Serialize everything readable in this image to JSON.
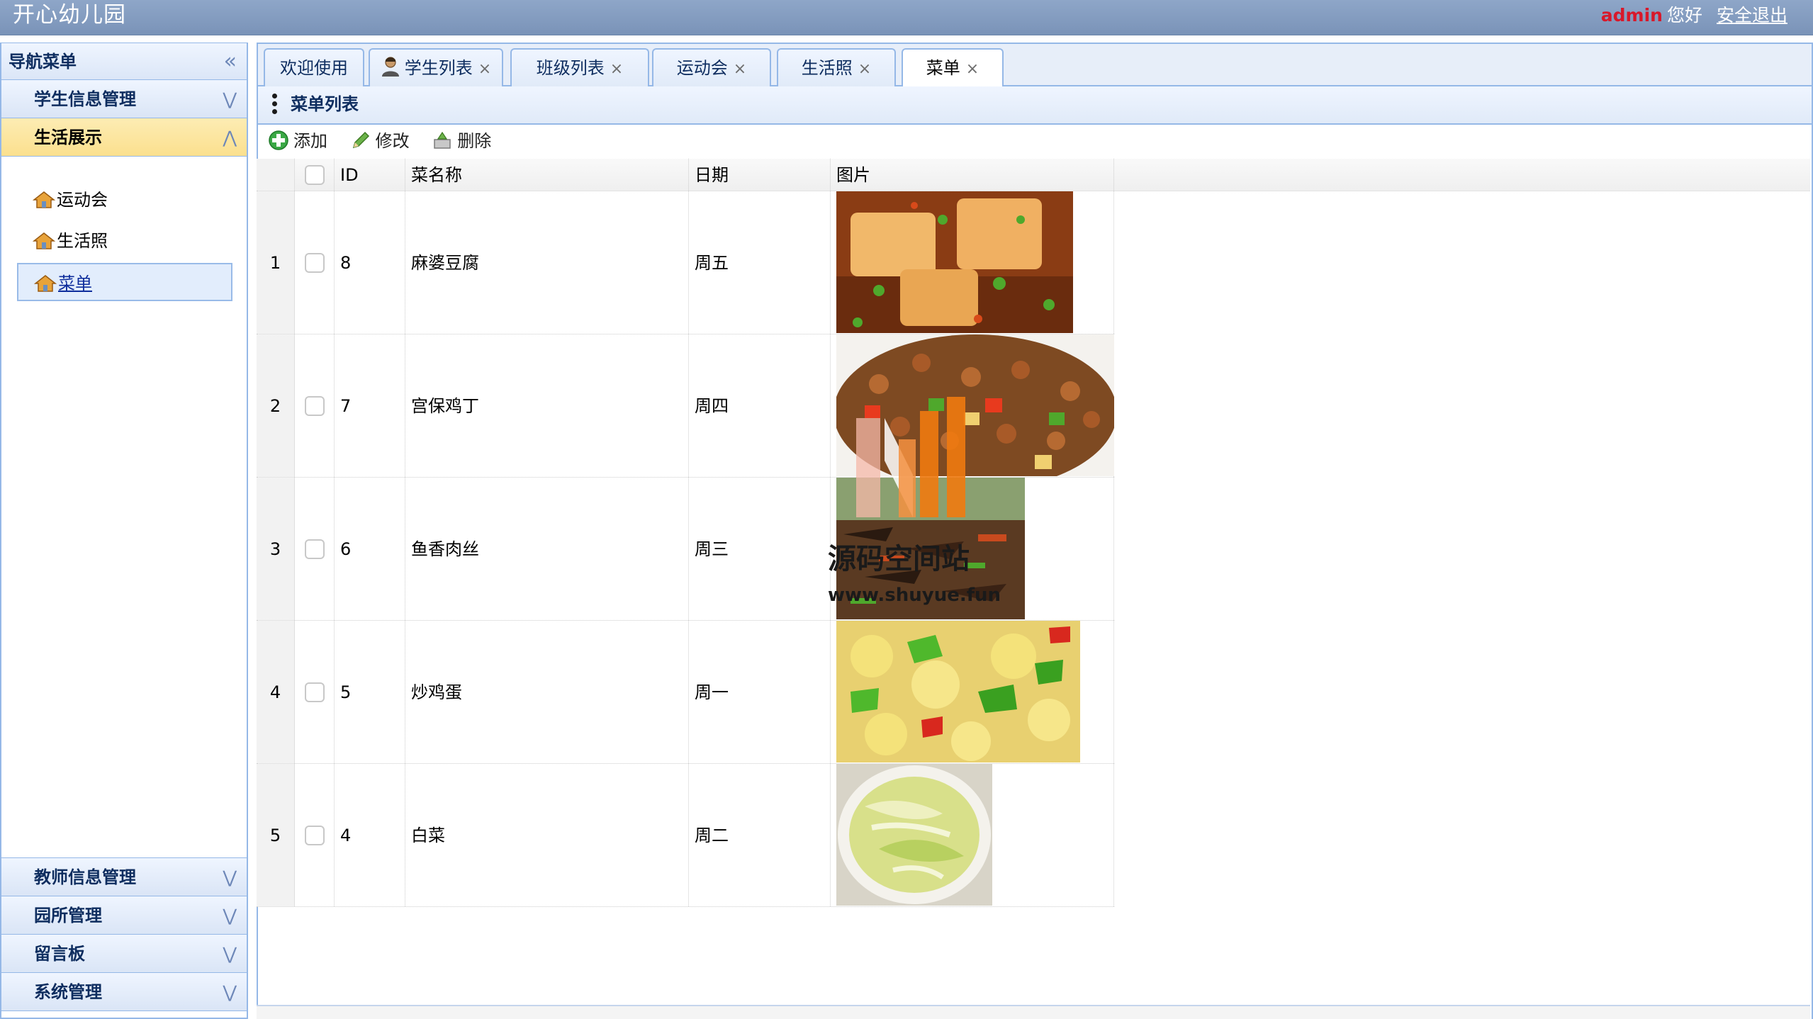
{
  "header": {
    "app_title": "开心幼儿园",
    "username": "admin",
    "greeting": "您好",
    "logout": "安全退出"
  },
  "sidebar": {
    "title": "导航菜单",
    "sections": [
      {
        "label": "学生信息管理",
        "state": "collapsed"
      },
      {
        "label": "生活展示",
        "state": "expanded"
      }
    ],
    "links": [
      {
        "label": "运动会",
        "selected": false
      },
      {
        "label": "生活照",
        "selected": false
      },
      {
        "label": "菜单",
        "selected": true
      }
    ],
    "bottom_sections": [
      {
        "label": "教师信息管理"
      },
      {
        "label": "园所管理"
      },
      {
        "label": "留言板"
      },
      {
        "label": "系统管理"
      }
    ]
  },
  "tabs": [
    {
      "label": "欢迎使用",
      "closable": false,
      "selected": false
    },
    {
      "label": "学生列表",
      "closable": true,
      "selected": false
    },
    {
      "label": "班级列表",
      "closable": true,
      "selected": false
    },
    {
      "label": "运动会",
      "closable": true,
      "selected": false
    },
    {
      "label": "生活照",
      "closable": true,
      "selected": false
    },
    {
      "label": "菜单",
      "closable": true,
      "selected": true
    }
  ],
  "panel": {
    "title": "菜单列表",
    "toolbar": {
      "add": "添加",
      "edit": "修改",
      "delete": "删除"
    }
  },
  "grid": {
    "columns": {
      "id": "ID",
      "name": "菜名称",
      "date": "日期",
      "image": "图片"
    },
    "rows": [
      {
        "num": "1",
        "id": "8",
        "name": "麻婆豆腐",
        "date": "周五",
        "image": "mapo-tofu-photo"
      },
      {
        "num": "2",
        "id": "7",
        "name": "宫保鸡丁",
        "date": "周四",
        "image": "kungpao-chicken-photo"
      },
      {
        "num": "3",
        "id": "6",
        "name": "鱼香肉丝",
        "date": "周三",
        "image": "yuxiang-pork-photo"
      },
      {
        "num": "4",
        "id": "5",
        "name": "炒鸡蛋",
        "date": "周一",
        "image": "scrambled-egg-photo"
      },
      {
        "num": "5",
        "id": "4",
        "name": "白菜",
        "date": "周二",
        "image": "cabbage-photo"
      }
    ]
  },
  "watermark": {
    "title": "源码空间站",
    "url": "www.shuyue.fun"
  },
  "colors": {
    "accent": "#95b8e7",
    "header": "#7a93b8",
    "active_section": "#fbe08e",
    "username": "#d8182a"
  }
}
